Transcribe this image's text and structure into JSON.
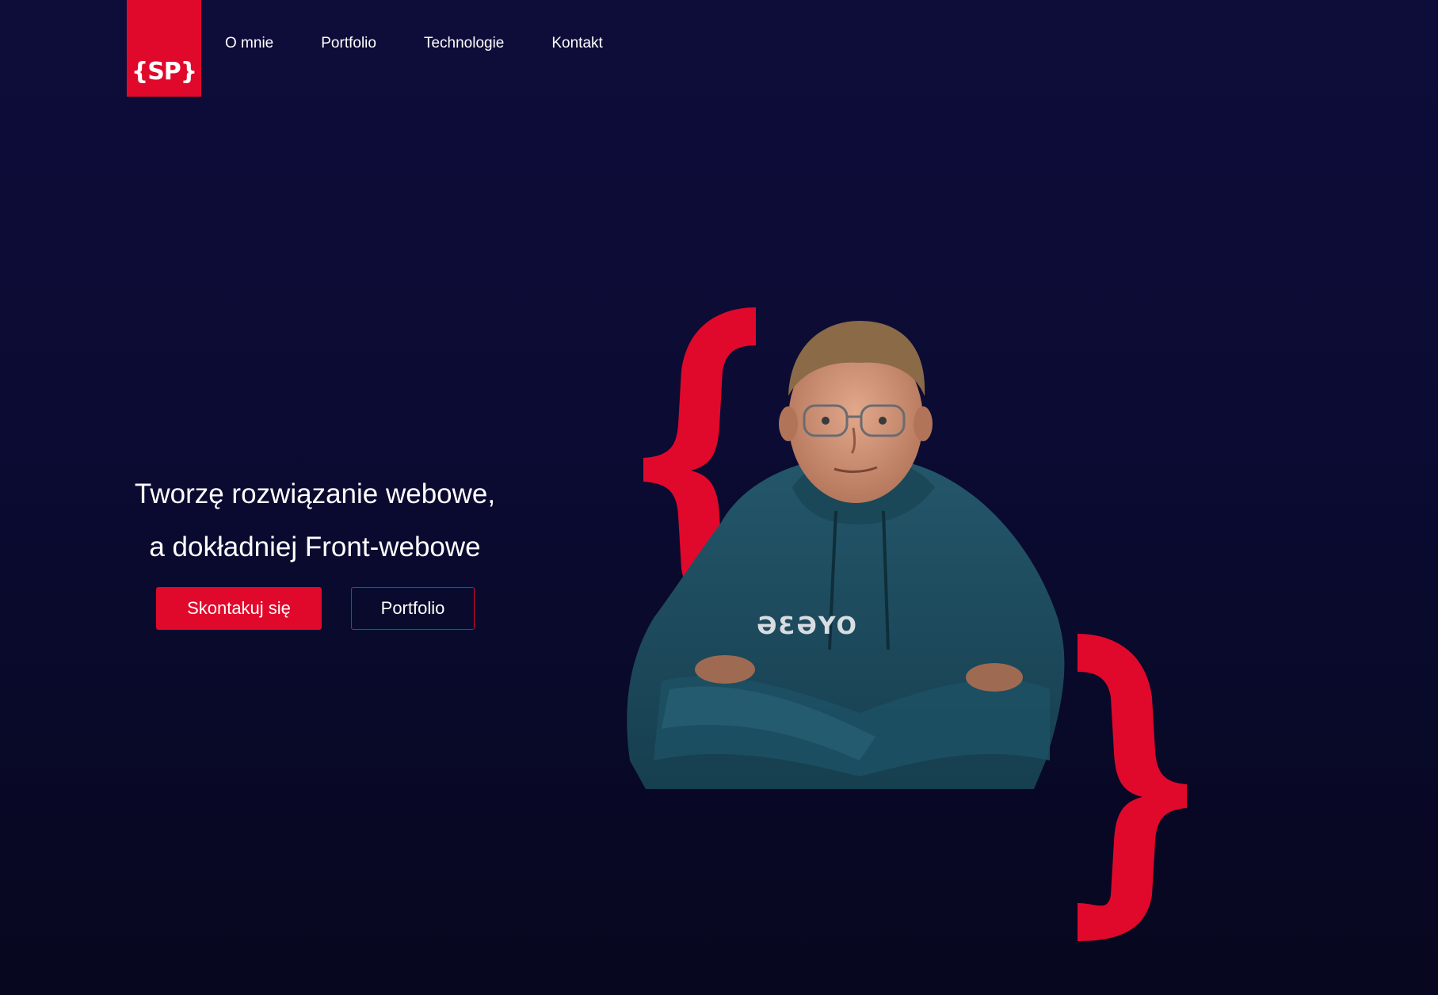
{
  "header": {
    "logo_text": "{SP}",
    "nav": [
      {
        "label": "O mnie"
      },
      {
        "label": "Portfolio"
      },
      {
        "label": "Technologie"
      },
      {
        "label": "Kontakt"
      }
    ]
  },
  "hero": {
    "line1": "Tworzę rozwiązanie webowe,",
    "line2": "a dokładniej Front-webowe",
    "primary_button": "Skontakuj się",
    "secondary_button": "Portfolio",
    "hoodie_text": "ƏƐƏYO"
  },
  "colors": {
    "accent": "#e0092b",
    "background_top": "#0e0d3a",
    "background_bottom": "#07071f",
    "hoodie": "#1f4f5c"
  },
  "icons": {
    "left_brace": "open-curly-brace-icon",
    "right_brace": "close-curly-brace-icon"
  }
}
